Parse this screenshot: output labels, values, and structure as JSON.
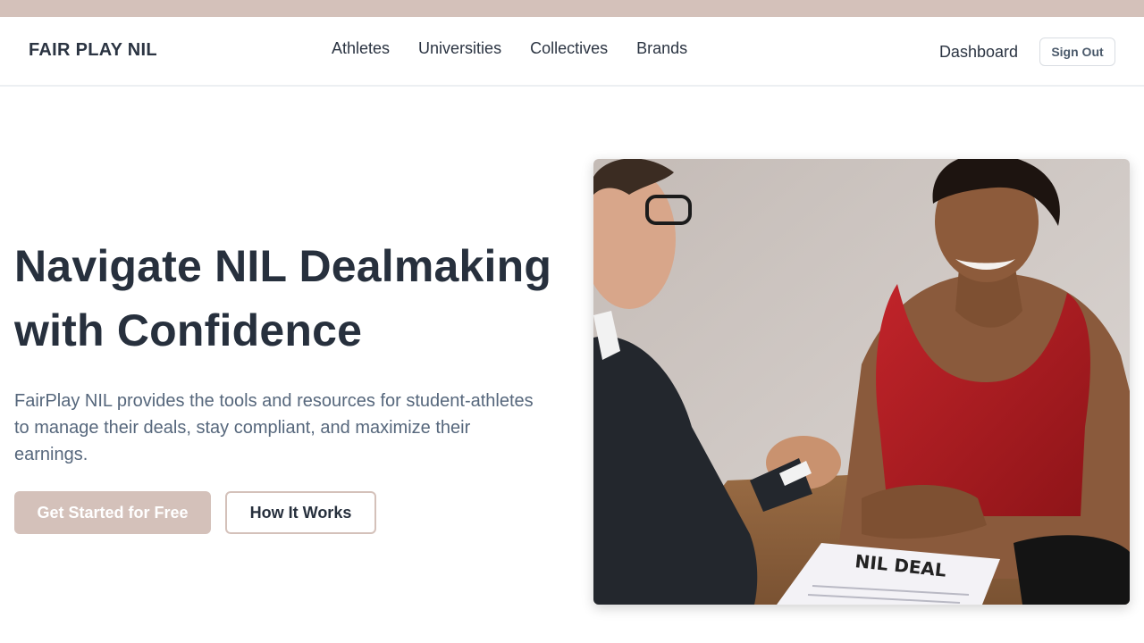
{
  "colors": {
    "accent": "#d4c1ba",
    "heading": "#27303d",
    "body_text": "#56677c"
  },
  "nav": {
    "logo": "FAIR PLAY NIL",
    "links": [
      "Athletes",
      "Universities",
      "Collectives",
      "Brands"
    ],
    "dashboard": "Dashboard",
    "sign_out": "Sign Out"
  },
  "hero": {
    "title_line1": "Navigate NIL Dealmaking",
    "title_line2": "with Confidence",
    "description": "FairPlay NIL provides the tools and resources for student-athletes to manage their deals, stay compliant, and maximize their earnings.",
    "primary_cta": "Get Started for Free",
    "secondary_cta": "How It Works",
    "image": {
      "document_text": "NIL DEAL"
    }
  }
}
